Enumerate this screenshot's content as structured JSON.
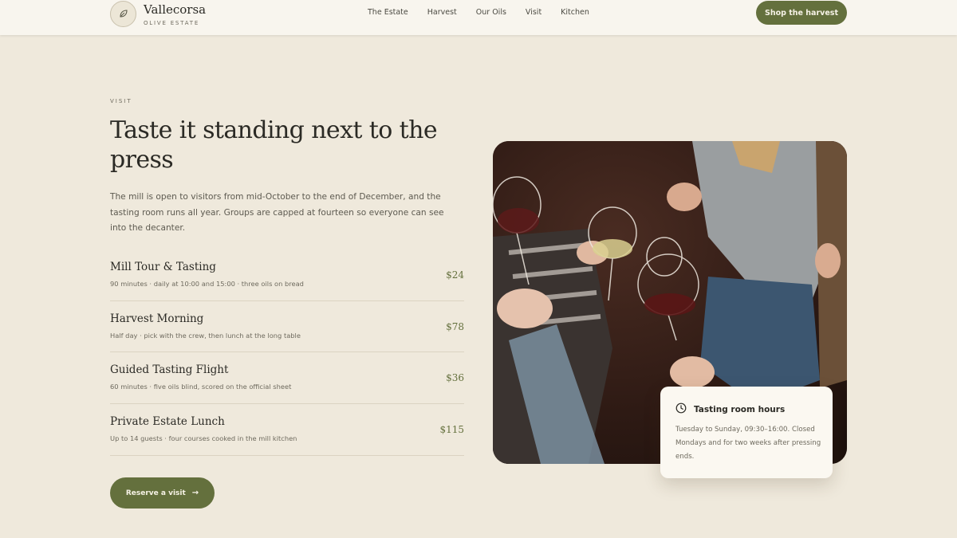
{
  "brand": {
    "name": "Vallecorsa",
    "tagline": "OLIVE ESTATE",
    "logo_icon": "leaf-icon"
  },
  "nav": {
    "items": [
      {
        "label": "The Estate"
      },
      {
        "label": "Harvest"
      },
      {
        "label": "Our Oils"
      },
      {
        "label": "Visit"
      },
      {
        "label": "Kitchen"
      }
    ],
    "cta_label": "Shop the harvest"
  },
  "visit": {
    "eyebrow": "VISIT",
    "title": "Taste it standing next to the press",
    "intro": "The mill is open to visitors from mid-October to the end of December, and the tasting room runs all year. Groups are capped at fourteen so everyone can see into the decanter.",
    "tours": [
      {
        "name": "Mill Tour & Tasting",
        "description": "90 minutes · daily at 10:00 and 15:00 · three oils on bread",
        "price": "$24"
      },
      {
        "name": "Harvest Morning",
        "description": "Half day · pick with the crew, then lunch at the long table",
        "price": "$78"
      },
      {
        "name": "Guided Tasting Flight",
        "description": "60 minutes · five oils blind, scored on the official sheet",
        "price": "$36"
      },
      {
        "name": "Private Estate Lunch",
        "description": "Up to 14 guests · four courses cooked in the mill kitchen",
        "price": "$115"
      }
    ],
    "reserve_label": "Reserve a visit",
    "reserve_icon": "arrow-right-icon"
  },
  "photo": {
    "subject": "wine-glasses-toast-photo"
  },
  "hours_card": {
    "icon": "clock-icon",
    "title": "Tasting room hours",
    "body": "Tuesday to Sunday, 09:30–16:00. Closed Mondays and for two weeks after pressing ends."
  },
  "colors": {
    "background": "#efe9dc",
    "header": "#f8f5ee",
    "accent": "#64703d",
    "text": "#2b2a25",
    "muted": "#6e6a5e"
  }
}
